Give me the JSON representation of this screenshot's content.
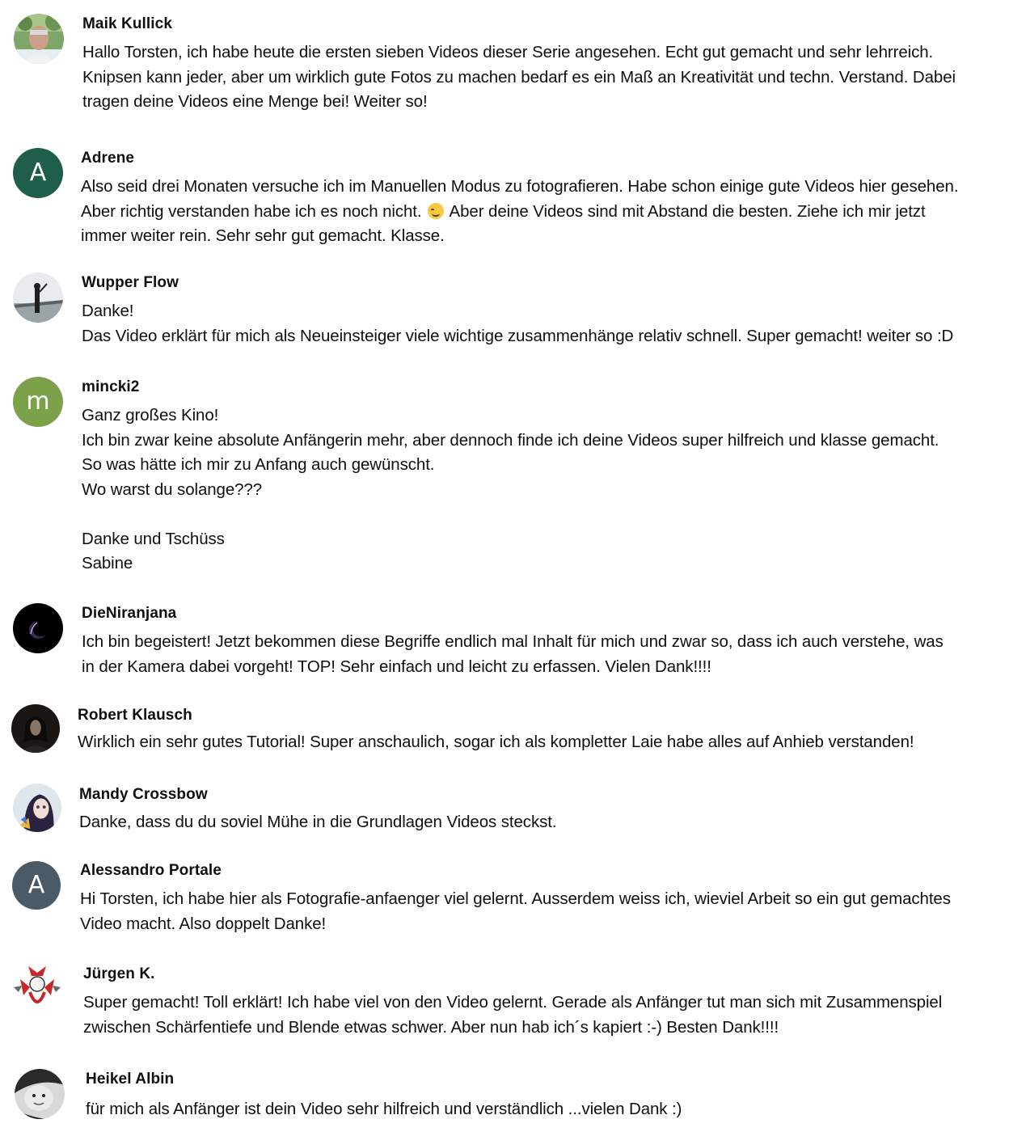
{
  "comments": [
    {
      "author": "Maik Kullick",
      "avatar_icon": "user-photo-avatar",
      "lines": [
        "Hallo Torsten, ich habe heute die ersten sieben Videos dieser Serie angesehen. Echt gut gemacht und sehr lehrreich.\nKnipsen kann jeder, aber um wirklich gute Fotos zu machen bedarf es ein Maß an Kreativität und techn. Verstand. Dabei\ntragen deine Videos eine Menge bei! Weiter so!"
      ]
    },
    {
      "author": "Adrene",
      "avatar_letter": "A",
      "avatar_color": "#1f5e4a",
      "text_before_emoji": "Also seid drei Monaten versuche ich im Manuellen Modus zu fotografieren. Habe schon einige gute Videos hier gesehen.\nAber richtig verstanden habe ich es noch nicht. ",
      "emoji_icon": "smiling-face-emoji-icon",
      "text_after_emoji": " Aber deine Videos sind mit Abstand die besten. Ziehe ich mir jetzt\nimmer weiter rein. Sehr sehr gut gemacht. Klasse."
    },
    {
      "author": "Wupper Flow",
      "avatar_icon": "person-silhouette-photo-avatar",
      "lines": [
        "Danke!\nDas Video erklärt für mich als Neueinsteiger viele wichtige zusammenhänge relativ schnell. Super gemacht! weiter so :D"
      ]
    },
    {
      "author": "mincki2",
      "avatar_letter": "m",
      "avatar_color": "#7ba24a",
      "lines": [
        "Ganz großes Kino!\nIch bin zwar keine absolute Anfängerin mehr, aber dennoch finde ich deine Videos super hilfreich und klasse gemacht.\nSo was hätte ich mir zu Anfang auch gewünscht.\nWo warst du solange???\n\nDanke und Tschüss\nSabine"
      ]
    },
    {
      "author": "DieNiranjana",
      "avatar_icon": "eclipse-photo-avatar",
      "lines": [
        "Ich bin begeistert! Jetzt bekommen diese Begriffe endlich mal Inhalt für mich und zwar so, dass ich auch verstehe, was\nin der Kamera dabei vorgeht! TOP! Sehr einfach und leicht zu erfassen. Vielen Dank!!!!"
      ]
    },
    {
      "author": "Robert Klausch",
      "avatar_icon": "dark-portrait-photo-avatar",
      "lines": [
        "Wirklich ein sehr gutes Tutorial! Super anschaulich, sogar ich als kompletter Laie habe alles auf Anhieb verstanden!"
      ]
    },
    {
      "author": "Mandy Crossbow",
      "avatar_icon": "illustrated-portrait-avatar",
      "lines": [
        "Danke, dass du du soviel Mühe in die Grundlagen Videos steckst."
      ]
    },
    {
      "author": "Alessandro Portale",
      "avatar_letter": "A",
      "avatar_color": "#4a5a66",
      "lines": [
        "Hi Torsten, ich habe hier als Fotografie-anfaenger viel gelernt. Ausserdem weiss ich, wieviel Arbeit so ein gut gemachtes\nVideo macht. Also doppelt Danke!"
      ]
    },
    {
      "author": "Jürgen K.",
      "avatar_icon": "crest-emblem-avatar",
      "lines": [
        "Super gemacht! Toll erklärt! Ich habe viel von den Video gelernt. Gerade als Anfänger tut man sich mit Zusammenspiel\nzwischen Schärfentiefe und Blende etwas schwer. Aber nun hab ich´s kapiert :-) Besten Dank!!!!"
      ]
    },
    {
      "author": "Heikel Albin",
      "avatar_icon": "child-photo-avatar",
      "lines": [
        "für mich als Anfänger ist dein Video sehr hilfreich und verständlich ...vielen Dank :)"
      ]
    }
  ]
}
